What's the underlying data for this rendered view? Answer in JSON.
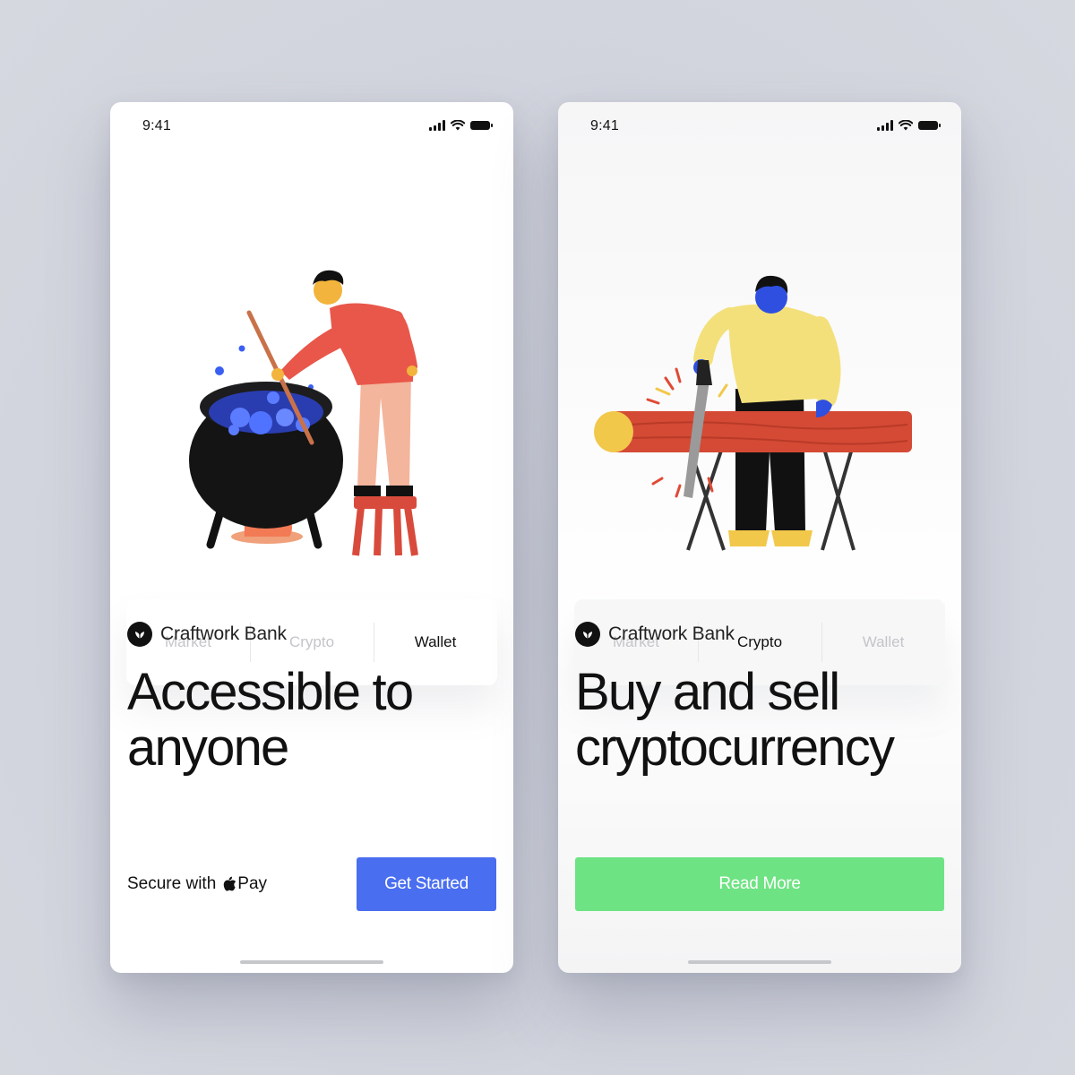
{
  "screens": [
    {
      "status_time": "9:41",
      "tabs": [
        {
          "label": "Market",
          "active": false
        },
        {
          "label": "Crypto",
          "active": false
        },
        {
          "label": "Wallet",
          "active": true
        }
      ],
      "brand": "Craftwork Bank",
      "headline_line1": "Accessible to",
      "headline_line2": "anyone",
      "secure_label": "Secure with",
      "pay_label": "Pay",
      "button_label": "Get Started",
      "button_color": "#4a6ef0"
    },
    {
      "status_time": "9:41",
      "tabs": [
        {
          "label": "Market",
          "active": false
        },
        {
          "label": "Crypto",
          "active": true
        },
        {
          "label": "Wallet",
          "active": false
        }
      ],
      "brand": "Craftwork Bank",
      "headline_line1": "Buy and sell",
      "headline_line2": "cryptocurrency",
      "button_label": "Read More",
      "button_color": "#6ee383"
    }
  ]
}
